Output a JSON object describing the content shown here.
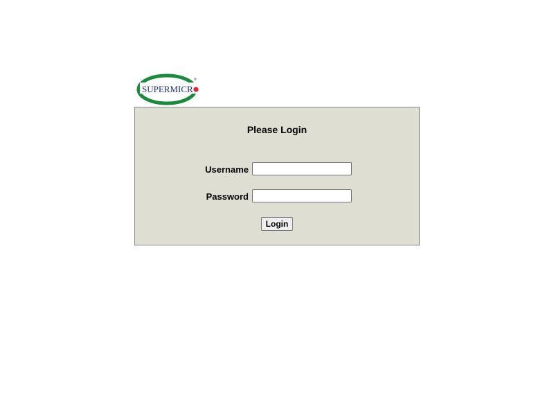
{
  "brand": {
    "logo_text": "SUPERMICR",
    "logo_ring_color": "#1a8a3c",
    "logo_text_color": "#1b2f7a",
    "logo_dot_color": "#e0262f",
    "logo_mark": "®"
  },
  "login": {
    "title": "Please Login",
    "username_label": "Username",
    "password_label": "Password",
    "username_value": "",
    "password_value": "",
    "submit_label": "Login"
  },
  "colors": {
    "panel_background": "#dfded3",
    "panel_border": "#8a8a8a"
  }
}
